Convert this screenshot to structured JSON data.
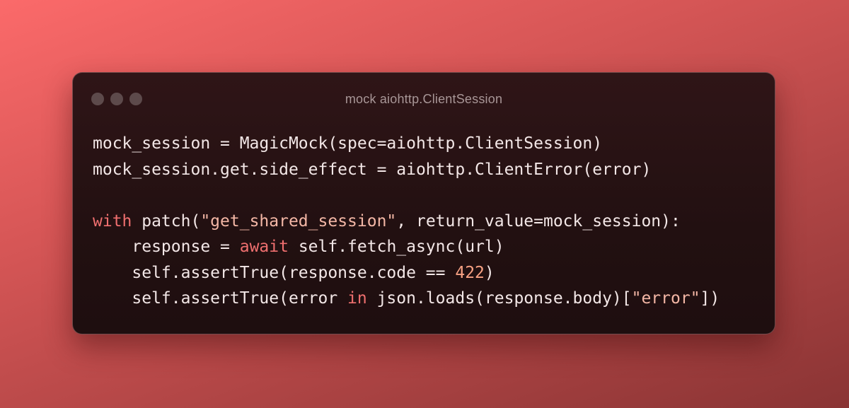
{
  "window": {
    "title": "mock aiohttp.ClientSession",
    "controls": [
      "close-dot",
      "minimize-dot",
      "maximize-dot"
    ]
  },
  "code": {
    "lines": [
      [
        {
          "t": "mock_session = MagicMock(spec=aiohttp.ClientSession)",
          "k": "plain"
        }
      ],
      [
        {
          "t": "mock_session.get.side_effect = aiohttp.ClientError(error)",
          "k": "plain"
        }
      ],
      [],
      [
        {
          "t": "with",
          "k": "kw"
        },
        {
          "t": " patch(",
          "k": "plain"
        },
        {
          "t": "\"get_shared_session\"",
          "k": "str"
        },
        {
          "t": ", return_value=mock_session):",
          "k": "plain"
        }
      ],
      [
        {
          "t": "    response = ",
          "k": "plain"
        },
        {
          "t": "await",
          "k": "kw"
        },
        {
          "t": " self.fetch_async(url)",
          "k": "plain"
        }
      ],
      [
        {
          "t": "    self.assertTrue(response.code == ",
          "k": "plain"
        },
        {
          "t": "422",
          "k": "num"
        },
        {
          "t": ")",
          "k": "plain"
        }
      ],
      [
        {
          "t": "    self.assertTrue(error ",
          "k": "plain"
        },
        {
          "t": "in",
          "k": "kw"
        },
        {
          "t": " json.loads(response.body)[",
          "k": "plain"
        },
        {
          "t": "\"error\"",
          "k": "str"
        },
        {
          "t": "])",
          "k": "plain"
        }
      ]
    ]
  },
  "colors": {
    "keyword": "#ef6f6f",
    "string": "#f4b7a6",
    "number": "#f7a183",
    "text": "#f3e7e7",
    "window_bg": "#241112",
    "background_accent": "#fb6a6a"
  }
}
